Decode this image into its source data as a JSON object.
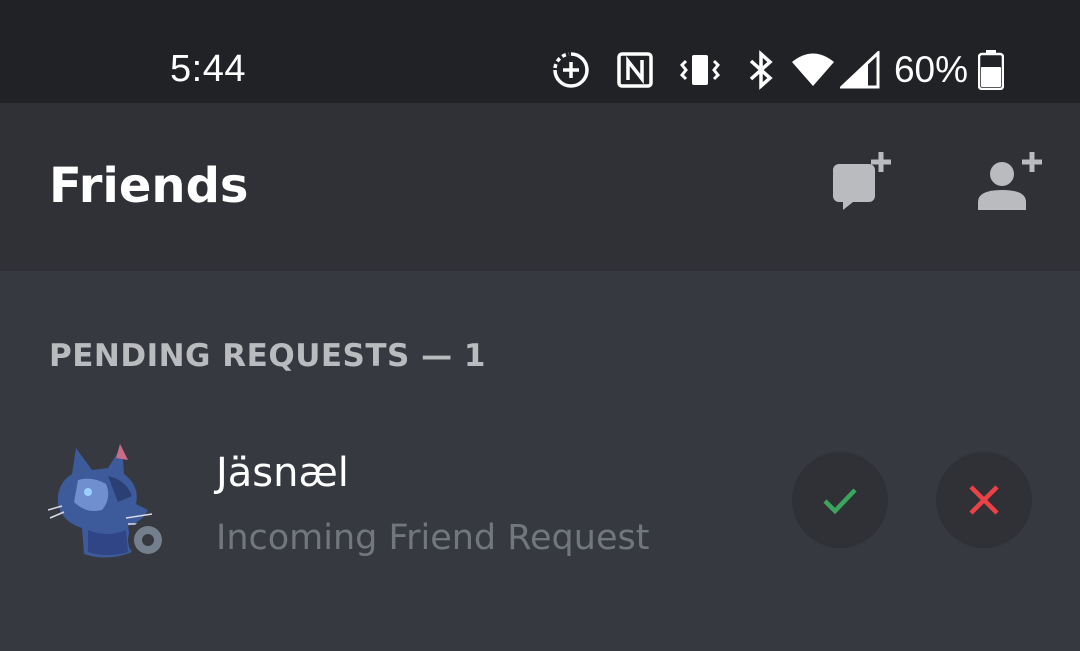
{
  "status_bar": {
    "time": "5:44",
    "battery_percent": "60%",
    "icons": [
      "data-saver-icon",
      "nfc-icon",
      "vibrate-icon",
      "bluetooth-icon",
      "wifi-icon",
      "cell-signal-icon",
      "battery-icon"
    ]
  },
  "header": {
    "title": "Friends",
    "actions": [
      "new-message-icon",
      "add-friend-icon"
    ]
  },
  "pending": {
    "section_label": "PENDING REQUESTS — 1",
    "requests": [
      {
        "username": "Jäsnæl",
        "subtitle": "Incoming Friend Request",
        "status": "offline"
      }
    ]
  },
  "colors": {
    "accept": "#3ba55d",
    "decline": "#ed4245",
    "background": "#36393f",
    "header_bg": "#2f3136",
    "statusbar_bg": "#202225"
  }
}
